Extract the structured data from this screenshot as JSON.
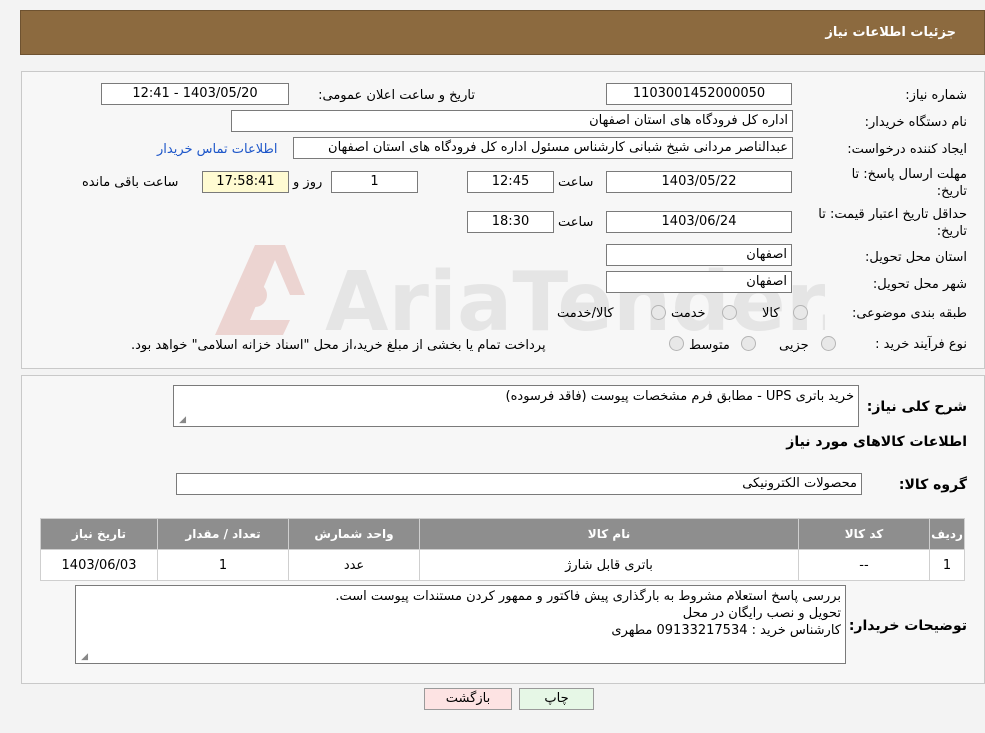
{
  "header": {
    "title": "جزئیات اطلاعات نیاز"
  },
  "watermark": {
    "text": "AriaTender.neT"
  },
  "form": {
    "need_number_label": "شماره نیاز:",
    "need_number": "1103001452000050",
    "announce_label": "تاریخ و ساعت اعلان عمومی:",
    "announce_value": "1403/05/20 - 12:41",
    "buyer_org_label": "نام دستگاه خریدار:",
    "buyer_org": "اداره کل فرودگاه های استان اصفهان",
    "creator_label": "ایجاد کننده درخواست:",
    "creator": "عبدالناصر مردانی شیخ شبانی کارشناس مسئول  اداره کل فرودگاه های استان اصفهان",
    "contact_link": "اطلاعات تماس خریدار",
    "deadline_label_1": "مهلت ارسال پاسخ: تا",
    "deadline_label_2": "تاریخ:",
    "deadline_date": "1403/05/22",
    "time_label": "ساعت",
    "deadline_time": "12:45",
    "days_value": "1",
    "days_label": "روز و",
    "remaining_time": "17:58:41",
    "remaining_label": "ساعت باقی مانده",
    "validity_label_1": "حداقل تاریخ اعتبار قیمت: تا",
    "validity_label_2": "تاریخ:",
    "validity_date": "1403/06/24",
    "validity_time": "18:30",
    "province_label": "استان محل تحویل:",
    "province": "اصفهان",
    "city_label": "شهر محل تحویل:",
    "city": "اصفهان",
    "category_label": "طبقه بندی موضوعی:",
    "category_options": [
      "کالا",
      "خدمت",
      "کالا/خدمت"
    ],
    "process_label": "نوع فرآیند خرید :",
    "process_options": [
      "جزیی",
      "متوسط"
    ],
    "process_note": "پرداخت تمام یا بخشی از مبلغ خرید،از محل \"اسناد خزانه اسلامی\" خواهد بود."
  },
  "details": {
    "summary_label": "شرح کلی نیاز:",
    "summary": "خرید باتری  UPS - مطابق فرم مشخصات پیوست (فاقد فرسوده)",
    "goods_info_title": "اطلاعات کالاهای مورد نیاز",
    "group_label": "گروه کالا:",
    "group": "محصولات الکترونیکی",
    "table": {
      "headers": [
        "ردیف",
        "کد کالا",
        "نام کالا",
        "واحد شمارش",
        "تعداد / مقدار",
        "تاریخ نیاز"
      ],
      "rows": [
        [
          "1",
          "--",
          "باتری قابل شارژ",
          "عدد",
          "1",
          "1403/06/03"
        ]
      ]
    },
    "buyer_notes_label": "توضیحات خریدار:",
    "buyer_notes": [
      "بررسی پاسخ استعلام مشروط  به بارگذاری پیش فاکتور و ممهور کردن مستندات پیوست است.",
      "تحویل و نصب رایگان در محل",
      "کارشناس خرید  :  09133217534 مطهری"
    ]
  },
  "buttons": {
    "print": "چاپ",
    "back": "بازگشت"
  },
  "colors": {
    "header_bg": "#8c6a3f",
    "table_header_bg": "#8e8e8e",
    "back_button_bg": "#fde3e3",
    "print_button_bg": "#e6f7e6"
  }
}
